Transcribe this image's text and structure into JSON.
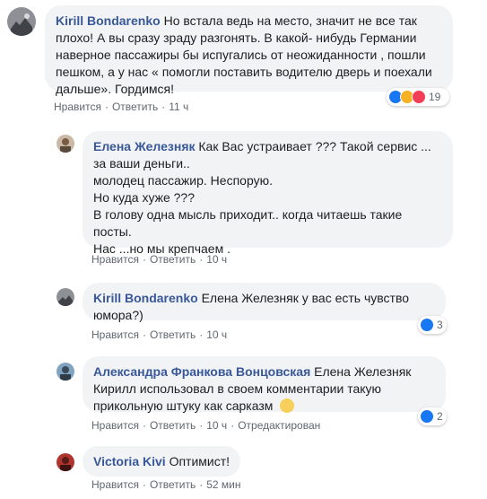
{
  "comments": [
    {
      "author": "Kirill Bondarenko",
      "text": "Но встала ведь на место, значит не все так плохо! А вы сразу зраду разгонять. В какой- нибудь Германии наверное пассажиры бы испугались от неожиданности , пошли пешком, а у нас « помогли поставить водителю дверь и поехали дальше». Гордимся!",
      "like": "Нравится",
      "reply": "Ответить",
      "time": "11 ч",
      "reactions_count": "19"
    },
    {
      "author": "Елена Железняк",
      "lines": [
        "Как Вас устраивает ??? Такой сервис ...",
        "за ваши деньги..",
        "молодец пассажир. Неспорую.",
        "Но куда хуже ???",
        "В голову одна мысль приходит.. когда читаешь такие",
        "посты.",
        "Нас ...но мы крепчаем ."
      ],
      "like": "Нравится",
      "reply": "Ответить",
      "time": "10 ч"
    },
    {
      "author": "Kirill Bondarenko",
      "text": "Елена Железняк у вас есть чувство юмора?)",
      "like": "Нравится",
      "reply": "Ответить",
      "time": "10 ч",
      "reactions_count": "3"
    },
    {
      "author": "Александра Франкова Вонцовская",
      "text": "Елена Железняк Кирилл использовал в своем комментарии такую прикольную штуку как сарказм",
      "like": "Нравится",
      "reply": "Ответить",
      "time": "10 ч",
      "edited": "Отредактирован",
      "reactions_count": "2"
    },
    {
      "author": "Victoria Kivi",
      "text": "Оптимист!",
      "like": "Нравится",
      "reply": "Ответить",
      "time": "52 мин"
    }
  ],
  "separator": "·",
  "colors": {
    "author_link": "#385898",
    "bubble_bg": "#f2f3f5",
    "like_blue": "#1877f2",
    "haha_yellow": "#f7b125",
    "love_red": "#f33e58"
  }
}
